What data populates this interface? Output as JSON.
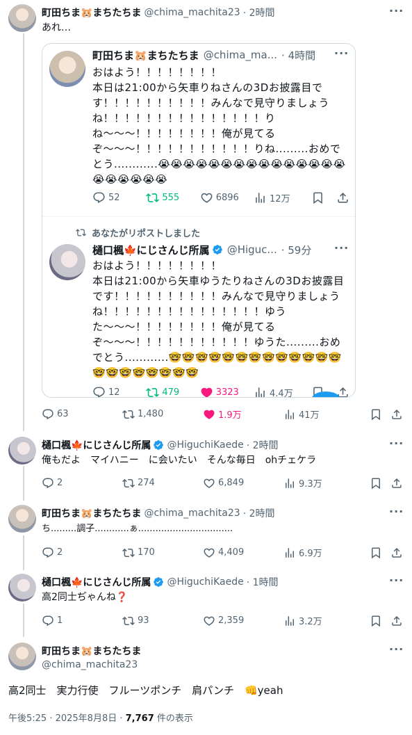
{
  "colors": {
    "retweet_active": "#00ba7c",
    "like_active": "#f91880",
    "verified": "#1d9bf0",
    "muted": "#536471"
  },
  "tweet1": {
    "name": "町田ちま🐹まちたちま",
    "handle": "@chima_machita23",
    "time": "· 2時間",
    "text": "あれ…",
    "more": "···",
    "replies": "63",
    "retweets": "1,480",
    "likes": "1.9万",
    "views": "41万"
  },
  "quote1": {
    "name": "町田ちま🐹まちたちま",
    "handle": "@chima_ma...",
    "time": "· 4時間",
    "more": "···",
    "text": "おはよう！！！！！！！！\n本日は21:00から矢車りねさんの3Dお披露目です！！！！！！！！！！みんなで見守りましょうね！！！！！！！！！！！！！！！り\nね〜〜〜！！！！！！！！俺が見てる\nぞ〜〜〜！！！！！！！！！！！りね.........おめでとう............😭😭😭😭😭😭😭😭😭😭😭😭😭😭😭😭😭😭😭😭😭",
    "replies": "52",
    "retweets": "555",
    "likes": "6896",
    "views": "12万"
  },
  "quote2": {
    "reposted_label": "あなたがリポストしました",
    "name": "樋口楓🍁にじさんじ所属",
    "handle": "@Higuc...",
    "time": "· 59分",
    "more": "···",
    "text": "おはよう！！！！！！！！\n本日は21:00から矢車ゆうたりねさんの3Dお披露目です！！！！！！！！！！みんなで見守りましょうね！！！！！！！！！！！！！！！ゆう\nた〜〜〜！！！！！！！！俺が見てる\nぞ〜〜〜！！！！！！！！！！！ゆうた.........おめでとう............🤓🤓🤓🤓🤓🤓🤓🤓🤓🤓🤓🤓🤓🤓🤓🤓🤓🤓🤓🤓🤓",
    "replies": "12",
    "retweets": "479",
    "likes": "3323",
    "views": "4.4万"
  },
  "tweet2": {
    "name": "樋口楓🍁にじさんじ所属",
    "handle": "@HiguchiKaede",
    "time": "· 2時間",
    "more": "···",
    "text": "俺もだよ　マイハニー　に会いたい　そんな毎日　ohチェケラ",
    "replies": "2",
    "retweets": "274",
    "likes": "6,849",
    "views": "9.3万"
  },
  "tweet3": {
    "name": "町田ちま🐹まちたちま",
    "handle": "@chima_machita23",
    "time": "· 2時間",
    "more": "···",
    "text": "ち.........調子............ぁ.................................",
    "replies": "2",
    "retweets": "170",
    "likes": "4,409",
    "views": "6.9万"
  },
  "tweet4": {
    "name": "樋口楓🍁にじさんじ所属",
    "handle": "@HiguchiKaede",
    "time": "· 1時間",
    "more": "···",
    "text": "高2同士ぢゃんね❓",
    "replies": "1",
    "retweets": "93",
    "likes": "2,359",
    "views": "3.2万"
  },
  "main": {
    "name": "町田ちま🐹まちたちま",
    "handle": "@chima_machita23",
    "more": "···",
    "text": "高2同士　実力行使　フルーツポンチ　肩パンチ　👊yeah",
    "timestamp": "午後5:25 · 2025年8月8日 · ",
    "views_count": "7,767",
    "views_label": " 件の表示"
  }
}
